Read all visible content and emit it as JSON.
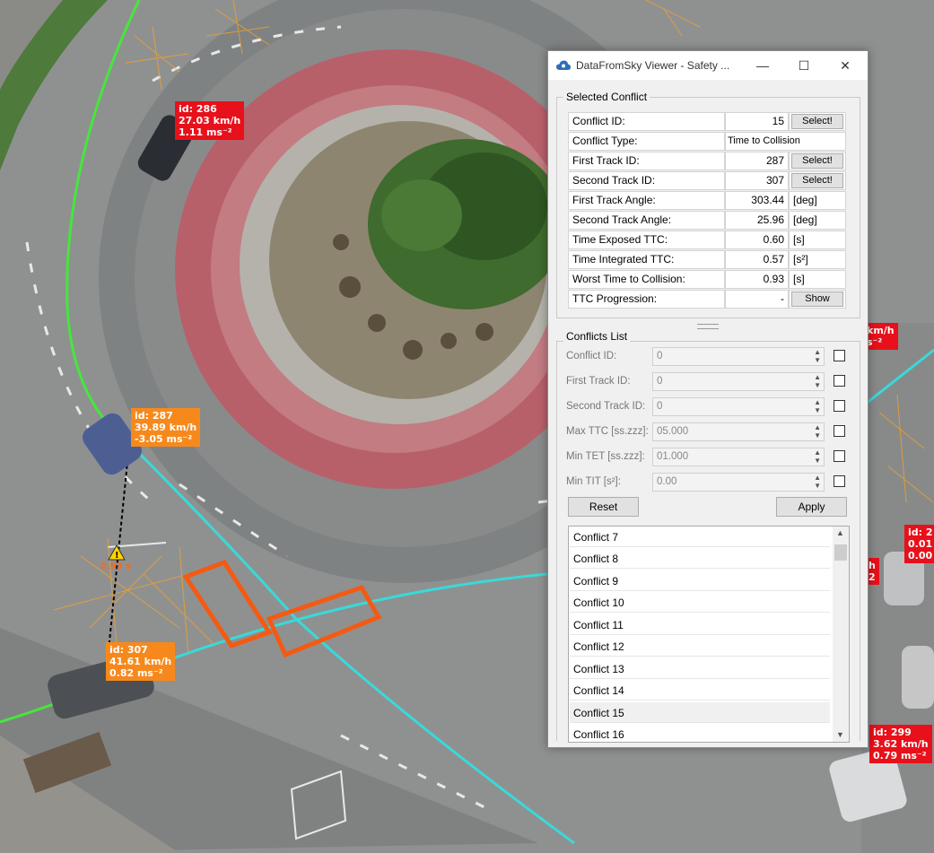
{
  "window": {
    "title": "DataFromSky Viewer - Safety ...",
    "minimize": "—",
    "maximize": "☐",
    "close": "✕"
  },
  "selected_conflict": {
    "group_title": "Selected Conflict",
    "rows": [
      {
        "label": "Conflict ID:",
        "value": "15",
        "button": "Select!"
      },
      {
        "label": "Conflict Type:",
        "value": "Time to Collision"
      },
      {
        "label": "First Track ID:",
        "value": "287",
        "button": "Select!"
      },
      {
        "label": "Second Track ID:",
        "value": "307",
        "button": "Select!"
      },
      {
        "label": "First Track Angle:",
        "value": "303.44",
        "unit": "[deg]"
      },
      {
        "label": "Second Track Angle:",
        "value": "25.96",
        "unit": "[deg]"
      },
      {
        "label": "Time Exposed TTC:",
        "value": "0.60",
        "unit": "[s]"
      },
      {
        "label": "Time Integrated TTC:",
        "value": "0.57",
        "unit": "[s²]"
      },
      {
        "label": "Worst Time to Collision:",
        "value": "0.93",
        "unit": "[s]"
      },
      {
        "label": "TTC Progression:",
        "value": "-",
        "button": "Show"
      }
    ]
  },
  "conflicts_list": {
    "group_title": "Conflicts List",
    "filters": [
      {
        "label": "Conflict ID:",
        "value": "0"
      },
      {
        "label": "First Track ID:",
        "value": "0"
      },
      {
        "label": "Second Track ID:",
        "value": "0"
      },
      {
        "label": "Max TTC [ss.zzz]:",
        "value": "05.000"
      },
      {
        "label": "Min TET [ss.zzz]:",
        "value": "01.000"
      },
      {
        "label": "Min TIT [s²]:",
        "value": "0.00"
      }
    ],
    "reset_label": "Reset",
    "apply_label": "Apply",
    "items": [
      "Conflict 7",
      "Conflict 8",
      "Conflict 9",
      "Conflict 10",
      "Conflict 11",
      "Conflict 12",
      "Conflict 13",
      "Conflict 14",
      "Conflict 15",
      "Conflict 16"
    ],
    "selected_item": "Conflict 15"
  },
  "scene": {
    "vehicles": [
      {
        "id": "id: 286",
        "speed": "27.03 km/h",
        "accel": "1.11 ms⁻²",
        "color": "red"
      },
      {
        "id": "id: 287",
        "speed": "39.89 km/h",
        "accel": "-3.05 ms⁻²",
        "color": "orange"
      },
      {
        "id": "id: 307",
        "speed": "41.61 km/h",
        "accel": "0.82 ms⁻²",
        "color": "orange"
      },
      {
        "id": "id: 299",
        "speed": "3.62 km/h",
        "accel": "0.79 ms⁻²",
        "color": "red"
      }
    ],
    "partial_tags": [
      {
        "line1": "km/h",
        "line2": "s⁻²"
      },
      {
        "line1": "id: 2",
        "line2": "0.01",
        "line3": "0.00"
      },
      {
        "line1": "h",
        "line2": "2"
      }
    ],
    "ttc_marker": "0.93 s",
    "colors": {
      "track_green": "#46e63c",
      "track_cyan": "#3ad9d9",
      "conflict": "#f45a12",
      "tag_red": "#e8101a",
      "tag_orange": "#f7891c"
    }
  }
}
